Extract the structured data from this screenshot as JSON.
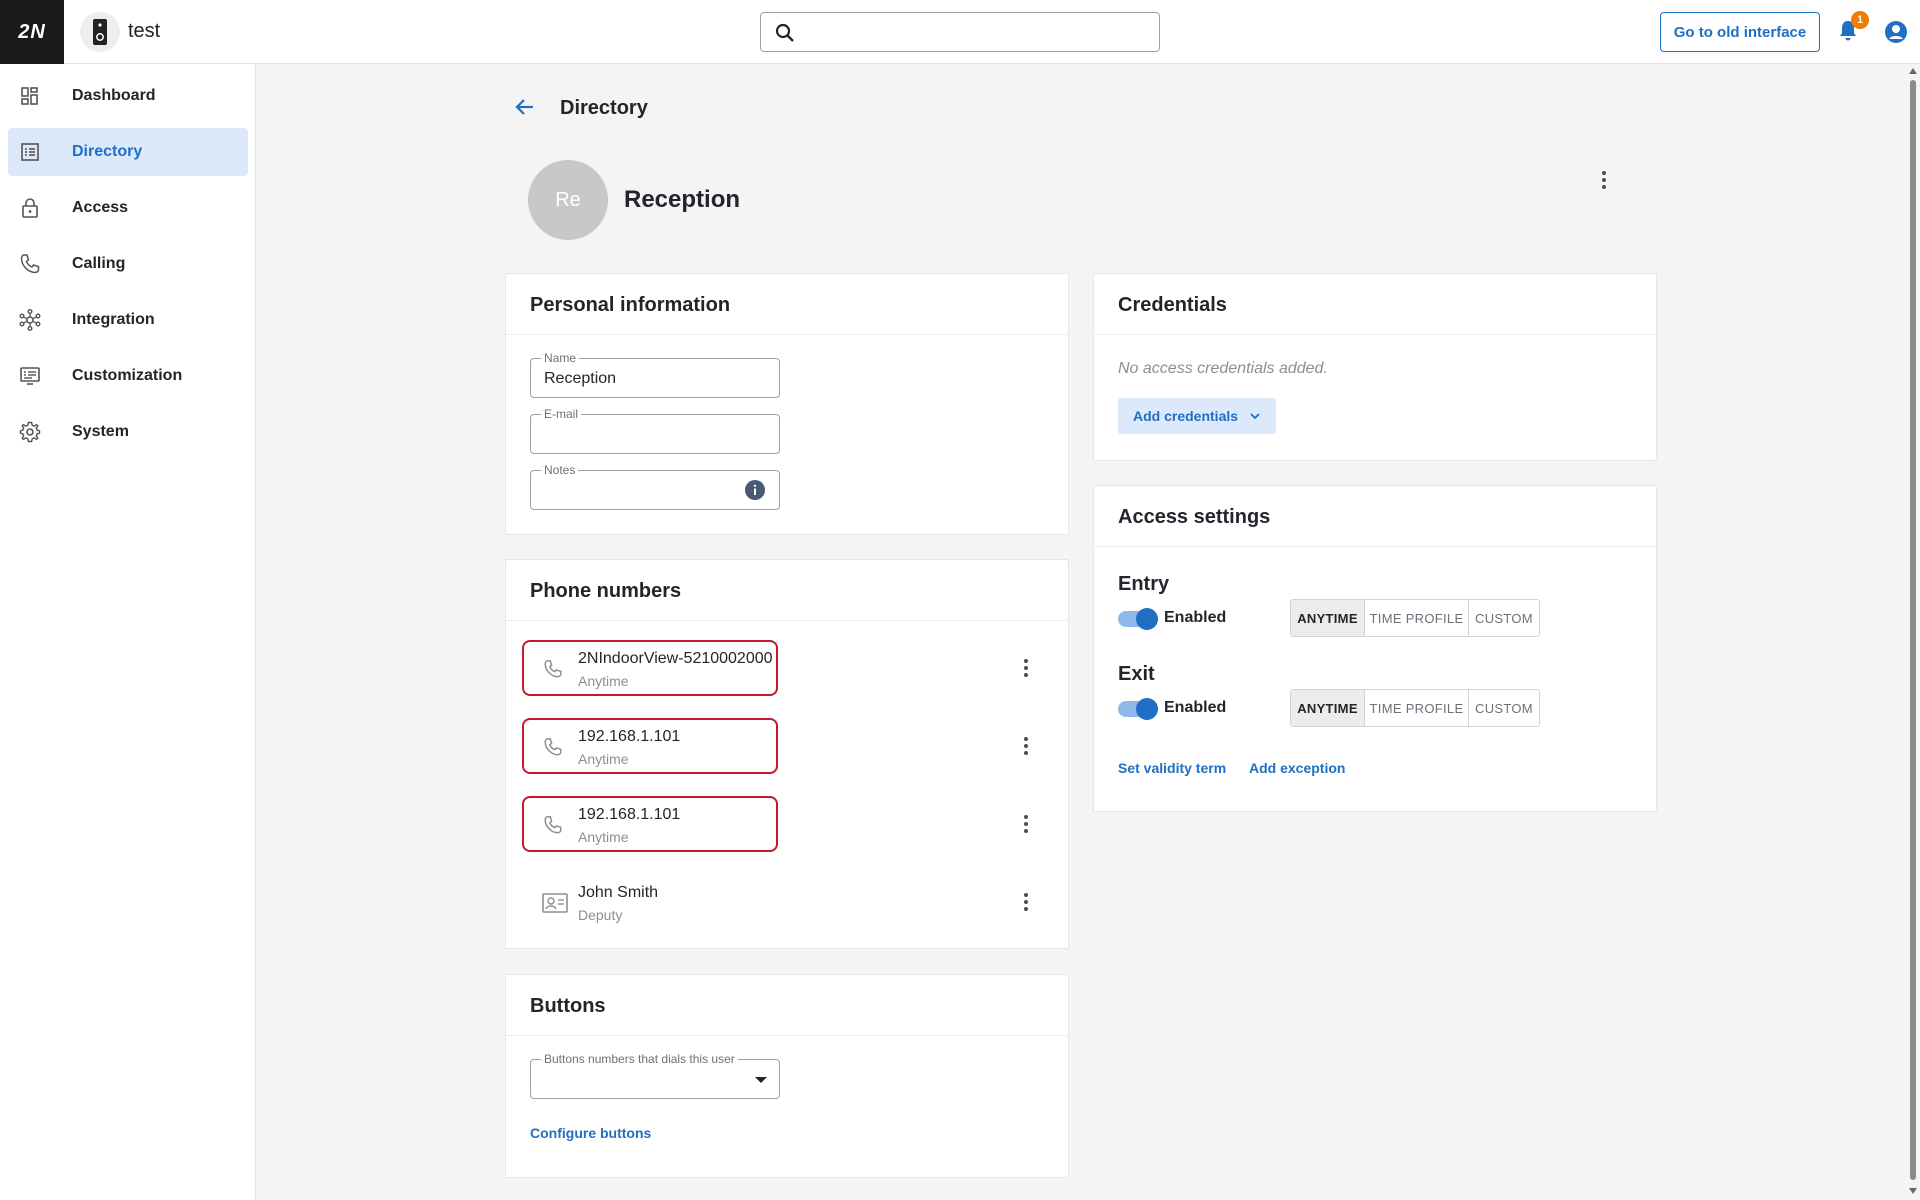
{
  "header": {
    "logo": "2N",
    "device_name": "test",
    "search_placeholder": "",
    "old_interface_label": "Go to old interface",
    "notification_count": "1"
  },
  "sidebar": {
    "items": [
      {
        "label": "Dashboard",
        "icon": "dashboard-icon"
      },
      {
        "label": "Directory",
        "icon": "directory-icon",
        "active": true
      },
      {
        "label": "Access",
        "icon": "lock-icon"
      },
      {
        "label": "Calling",
        "icon": "phone-icon"
      },
      {
        "label": "Integration",
        "icon": "integration-icon"
      },
      {
        "label": "Customization",
        "icon": "customization-icon"
      },
      {
        "label": "System",
        "icon": "gear-icon"
      }
    ]
  },
  "page": {
    "title": "Directory",
    "avatar_initials": "Re",
    "user_name": "Reception"
  },
  "personal": {
    "title": "Personal information",
    "name_label": "Name",
    "name_value": "Reception",
    "email_label": "E-mail",
    "email_value": "",
    "notes_label": "Notes",
    "notes_value": ""
  },
  "phones": {
    "title": "Phone numbers",
    "items": [
      {
        "main": "2NIndoorView-5210002000",
        "sub": "Anytime",
        "icon": "phone-icon",
        "highlighted": true
      },
      {
        "main": "192.168.1.101",
        "sub": "Anytime",
        "icon": "phone-icon",
        "highlighted": true
      },
      {
        "main": "192.168.1.101",
        "sub": "Anytime",
        "icon": "phone-icon",
        "highlighted": true
      },
      {
        "main": "John Smith",
        "sub": "Deputy",
        "icon": "contact-card-icon",
        "highlighted": false
      }
    ]
  },
  "buttons_card": {
    "title": "Buttons",
    "select_label": "Buttons numbers that dials this user",
    "select_value": "",
    "configure_label": "Configure buttons"
  },
  "credentials": {
    "title": "Credentials",
    "empty_text": "No access credentials added.",
    "add_label": "Add credentials"
  },
  "access": {
    "title": "Access settings",
    "entry_label": "Entry",
    "exit_label": "Exit",
    "enabled_label": "Enabled",
    "modes": [
      "ANYTIME",
      "TIME PROFILE",
      "CUSTOM"
    ],
    "entry_selected": "ANYTIME",
    "exit_selected": "ANYTIME",
    "entry_enabled": true,
    "exit_enabled": true,
    "validity_label": "Set validity term",
    "exception_label": "Add exception"
  },
  "colors": {
    "accent": "#1f6fc5",
    "highlight_outline": "#c21a2b",
    "badge": "#f07c00"
  }
}
